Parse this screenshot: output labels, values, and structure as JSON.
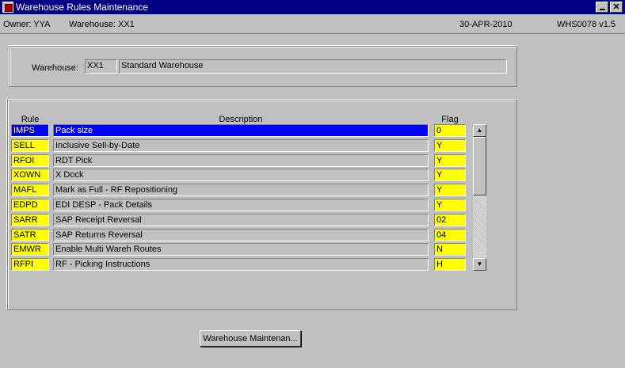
{
  "window": {
    "title": "Warehouse Rules Maintenance",
    "minimize_label": "_",
    "close_label": "✕"
  },
  "info": {
    "owner": "Owner:  YYA",
    "warehouse": "Warehouse:  XX1",
    "date": "30-APR-2010",
    "form_id": "WHS0078  v1.5"
  },
  "header_panel": {
    "warehouse_label": "Warehouse:",
    "warehouse_code": "XX1",
    "warehouse_name": "Standard Warehouse"
  },
  "rules_table": {
    "columns": {
      "rule": "Rule",
      "description": "Description",
      "flag": "Flag"
    },
    "rows": [
      {
        "rule": "IMPS",
        "description": "Pack size",
        "flag": "0"
      },
      {
        "rule": "SELL",
        "description": "Inclusive Sell-by-Date",
        "flag": "Y"
      },
      {
        "rule": "RFOI",
        "description": "RDT Pick",
        "flag": "Y"
      },
      {
        "rule": "XOWN",
        "description": "X Dock",
        "flag": "Y"
      },
      {
        "rule": "MAFL",
        "description": "Mark as Full - RF Repositioning",
        "flag": "Y"
      },
      {
        "rule": "EDPD",
        "description": "EDI DESP - Pack Details",
        "flag": "Y"
      },
      {
        "rule": "SARR",
        "description": "SAP Receipt Reversal",
        "flag": "02"
      },
      {
        "rule": "SATR",
        "description": "SAP Returns Reversal",
        "flag": "04"
      },
      {
        "rule": "EMWR",
        "description": "Enable Multi Wareh Routes",
        "flag": "N"
      },
      {
        "rule": "RFPI",
        "description": "RF - Picking Instructions",
        "flag": "H"
      }
    ],
    "selected_index": 0
  },
  "buttons": {
    "warehouse_maintenance": "Warehouse Maintenan..."
  },
  "colors": {
    "titlebar": "#000080",
    "selection": "#0000ff",
    "required_field": "#ffff00",
    "background": "#c0c0c0"
  },
  "icons": {
    "app": "oracle-forms-icon",
    "scroll_up": "arrow-up-icon",
    "scroll_down": "arrow-down-icon"
  }
}
